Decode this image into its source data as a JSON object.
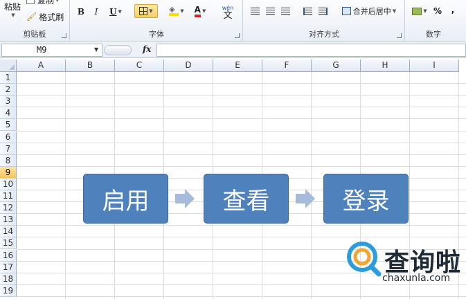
{
  "ribbon": {
    "clipboard": {
      "paste_label": "粘贴",
      "copy_label": "复制",
      "format_painter_label": "格式刷",
      "group_label": "剪贴板"
    },
    "font": {
      "bold": "B",
      "italic": "I",
      "underline": "U",
      "font_color_glyph": "A",
      "phonetic_glyph": "wén",
      "phonetic_char": "文",
      "group_label": "字体"
    },
    "alignment": {
      "merge_center_label": "合并后居中",
      "group_label": "对齐方式"
    },
    "number": {
      "percent": "%",
      "comma": ",",
      "group_label": "数字"
    }
  },
  "formula_bar": {
    "name_box": "M9",
    "fx_label": "fx",
    "formula": ""
  },
  "sheet": {
    "columns": [
      "A",
      "B",
      "C",
      "D",
      "E",
      "F",
      "G",
      "H",
      "I"
    ],
    "rows": [
      "1",
      "2",
      "3",
      "4",
      "5",
      "6",
      "7",
      "8",
      "9",
      "10",
      "11",
      "12",
      "13",
      "14",
      "15",
      "16",
      "17",
      "18",
      "19"
    ],
    "active_row": "9"
  },
  "smartart": {
    "steps": [
      "启用",
      "查看",
      "登录"
    ],
    "fill_color": "#4F81BD",
    "arrow_color": "#A7BCDB"
  },
  "watermark": {
    "brand": "查询啦",
    "url": "chaxunla.com",
    "accent": "#2D9CDB"
  }
}
